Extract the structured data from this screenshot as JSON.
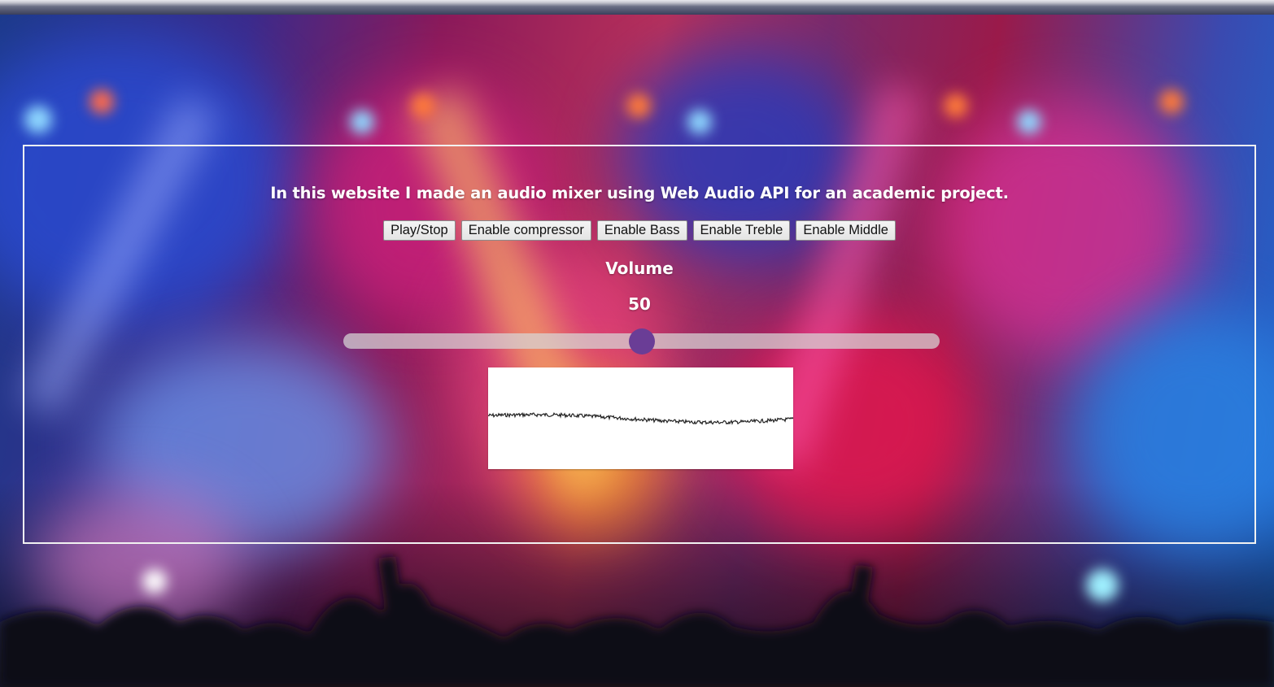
{
  "page": {
    "description": "In this website I made an audio mixer using Web Audio API for an academic project."
  },
  "controls": {
    "buttons": [
      {
        "label": "Play/Stop",
        "name": "play-stop-button"
      },
      {
        "label": "Enable compressor",
        "name": "enable-compressor-button"
      },
      {
        "label": "Enable Bass",
        "name": "enable-bass-button"
      },
      {
        "label": "Enable Treble",
        "name": "enable-treble-button"
      },
      {
        "label": "Enable Middle",
        "name": "enable-middle-button"
      }
    ]
  },
  "volume": {
    "label": "Volume",
    "value": "50",
    "min": 0,
    "max": 100,
    "fraction": 0.5
  },
  "colors": {
    "panel_border": "#f2f2f2",
    "text": "#ffffff",
    "slider_thumb": "#6a3d96",
    "slider_track": "#d7d7d7",
    "waveform_background": "#ffffff",
    "waveform_line": "#222222"
  }
}
